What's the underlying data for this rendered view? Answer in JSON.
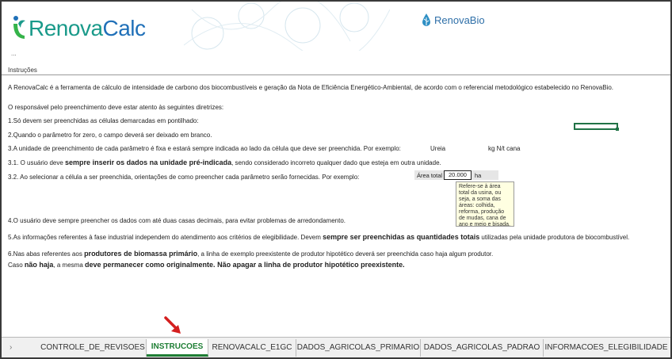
{
  "header": {
    "logo_part1": "Renova",
    "logo_part2": "Calc",
    "partner_logo": "RenovaBio"
  },
  "dots": "...",
  "section_title": "Instruções",
  "paragraphs": {
    "intro": "A RenovaCalc é a ferramenta de cálculo de intensidade de carbono dos biocombustíveis e geração da Nota de Eficiência Energético-Ambiental, de acordo com o referencial metodológico estabelecido no RenovaBio.",
    "responsible": "O responsável pelo preenchimento deve estar atento às seguintes diretrizes:",
    "item1": "1.Só devem ser preenchidas as células demarcadas em pontilhado:",
    "item2": "2.Quando o parâmetro for zero, o campo deverá ser deixado em branco.",
    "item3": "3.A unidade de preenchimento de cada parâmetro é fixa e estará sempre indicada ao lado da célula que deve ser preenchida. Por exemplo:",
    "item3_ex_name": "Ureia",
    "item3_ex_unit": "kg N/t cana",
    "item31_a": "3.1. O usuário deve ",
    "item31_b": "sempre inserir os dados na unidade pré-indicada",
    "item31_c": ", sendo considerado incorreto qualquer dado que esteja em outra unidade.",
    "item32": "3.2. Ao selecionar a célula a ser preenchida, orientações de como preencher cada parâmetro serão fornecidas.   Por exemplo:",
    "item4": "4.O usuário deve sempre preencher os dados com até duas casas decimais, para evitar problemas de arredondamento.",
    "item5_a": "5.As informações referentes à fase industrial independem do atendimento aos critérios de elegibilidade. Devem ",
    "item5_b": "sempre ser preenchidas as quantidades totais",
    "item5_c": " utilizadas pela unidade produtora de biocombustível.",
    "item6_a": "6.Nas abas referentes aos ",
    "item6_b": "produtores de biomassa primário",
    "item6_c": ", a linha de exemplo preexistente de produtor hipotético deverá ser preenchida caso haja algum produtor.",
    "item7_a": "Caso ",
    "item7_b": "não haja",
    "item7_c": ", a mesma ",
    "item7_d": "deve permanecer como originalmente.",
    "item7_e": " Não apagar a linha de produtor hipotético preexistente."
  },
  "example_area": {
    "label": "Área total",
    "value": "20.000",
    "unit": "ha"
  },
  "tooltip": "Refere-se à área total da usina, ou seja, a soma das áreas: colhida, reforma, produção de mudas, cana de ano e meio e bisada.",
  "tabs": [
    {
      "label": "CONTROLE_DE_REVISOES",
      "active": false
    },
    {
      "label": "INSTRUCOES",
      "active": true
    },
    {
      "label": "RENOVACALC_E1GC",
      "active": false
    },
    {
      "label": "DADOS_AGRICOLAS_PRIMARIO",
      "active": false
    },
    {
      "label": "DADOS_AGRICOLAS_PADRAO",
      "active": false
    },
    {
      "label": "INFORMACOES_ELEGIBILIDADE",
      "active": false
    }
  ],
  "tab_nav_arrow": "›",
  "colors": {
    "active_tab": "#1e7e34",
    "logo_teal": "#1a9a8a",
    "logo_blue": "#2070b8",
    "arrow_red": "#d41f1f"
  }
}
